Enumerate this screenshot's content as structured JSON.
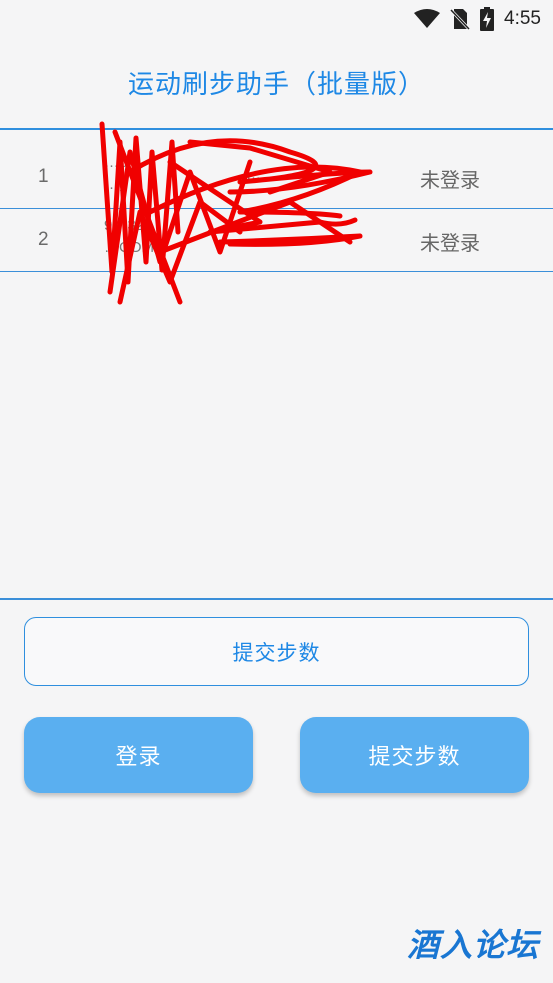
{
  "status_bar": {
    "time": "4:55",
    "icons": [
      "wifi-icon",
      "no-sim-icon",
      "battery-charging-icon"
    ]
  },
  "header": {
    "title": "运动刷步助手（批量版）"
  },
  "accounts": [
    {
      "index": "1",
      "user_line1": "…b",
      "user_line2": "…g",
      "password": "…",
      "status": "未登录"
    },
    {
      "index": "2",
      "user_line1": "9…320",
      "user_line2": "…COM",
      "password": "…",
      "status": "未登录"
    }
  ],
  "buttons": {
    "submit_all_label": "提交步数",
    "login_label": "登录",
    "submit_label": "提交步数"
  },
  "watermark": {
    "text": "酒入论坛"
  },
  "colors": {
    "accent": "#1e88e5",
    "button_fill": "#5aaff0",
    "background": "#f5f5f6",
    "scribble": "#f00000"
  }
}
